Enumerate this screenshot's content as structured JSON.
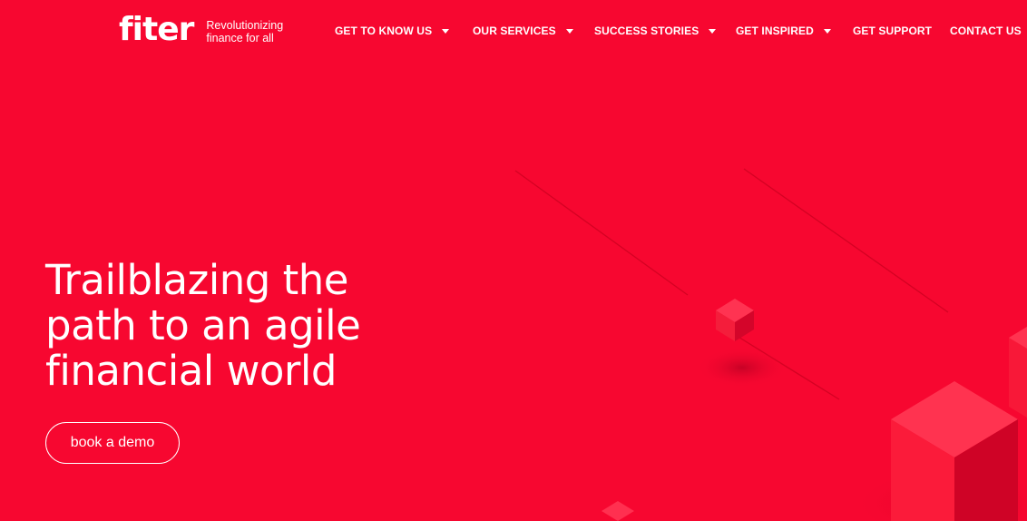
{
  "brand": {
    "logo_text": "fiter",
    "tagline_line1": "Revolutionizing",
    "tagline_line2": "finance for all"
  },
  "nav": {
    "items": [
      {
        "label": "GET TO KNOW US",
        "has_dropdown": true
      },
      {
        "label": "OUR SERVICES",
        "has_dropdown": true
      },
      {
        "label": "SUCCESS STORIES",
        "has_dropdown": true
      },
      {
        "label": "GET INSPIRED",
        "has_dropdown": true
      },
      {
        "label": "GET SUPPORT",
        "has_dropdown": false
      },
      {
        "label": "CONTACT US",
        "has_dropdown": false
      }
    ]
  },
  "hero": {
    "title_line1": "Trailblazing the",
    "title_line2": "path to an agile",
    "title_line3": "financial world",
    "cta_label": "book a demo"
  },
  "colors": {
    "background": "#f70730",
    "text": "#ffffff"
  },
  "icons": {
    "dropdown": "caret-down-icon"
  }
}
